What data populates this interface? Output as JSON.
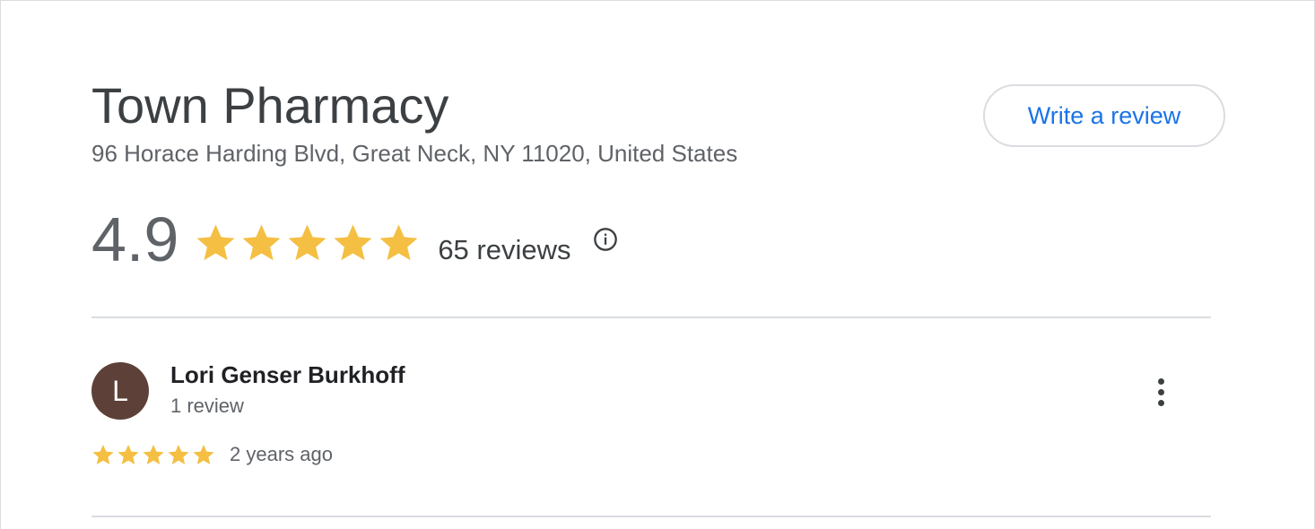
{
  "place": {
    "title": "Town Pharmacy",
    "address": "96 Horace Harding Blvd, Great Neck, NY 11020, United States"
  },
  "actions": {
    "write_review_label": "Write a review"
  },
  "summary": {
    "rating_text": "4.9",
    "rating_value": 4.9,
    "star_count": 5,
    "reviews_text": "65 reviews",
    "info_icon": "info-icon"
  },
  "reviews": [
    {
      "avatar_letter": "L",
      "avatar_color": "#5d4037",
      "author": "Lori Genser Burkhoff",
      "author_meta": "1 review",
      "stars": 5,
      "time": "2 years ago",
      "menu_icon": "more-vert-icon"
    }
  ],
  "colors": {
    "star": "#f4bf42",
    "link": "#1a73e8"
  }
}
